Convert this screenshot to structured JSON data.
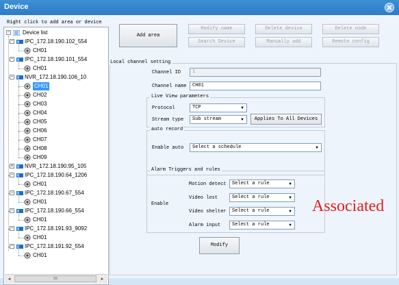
{
  "window": {
    "title": "Device"
  },
  "tree": {
    "hint": "Right click to add area or device",
    "root": "Device list",
    "items": [
      {
        "label": "IPC_172.18.190.102_554",
        "type": "device"
      },
      {
        "label": "CH01",
        "type": "channel"
      },
      {
        "label": "IPC_172.18.190.101_554",
        "type": "device"
      },
      {
        "label": "CH01",
        "type": "channel"
      },
      {
        "label": "NVR_172.18.190.106_10",
        "type": "device"
      },
      {
        "label": "CH01",
        "type": "channel",
        "selected": true
      },
      {
        "label": "CH02",
        "type": "channel"
      },
      {
        "label": "CH03",
        "type": "channel"
      },
      {
        "label": "CH04",
        "type": "channel"
      },
      {
        "label": "CH05",
        "type": "channel"
      },
      {
        "label": "CH06",
        "type": "channel"
      },
      {
        "label": "CH07",
        "type": "channel"
      },
      {
        "label": "CH08",
        "type": "channel"
      },
      {
        "label": "CH09",
        "type": "channel"
      },
      {
        "label": "NVR_172.18.190.95_105",
        "type": "device",
        "collapsed": true
      },
      {
        "label": "IPC_172.18.190.64_1206",
        "type": "device"
      },
      {
        "label": "CH01",
        "type": "channel"
      },
      {
        "label": "IPC_172.18.190.67_554",
        "type": "device"
      },
      {
        "label": "CH01",
        "type": "channel"
      },
      {
        "label": "IPC_172.18.190.66_554",
        "type": "device"
      },
      {
        "label": "CH01",
        "type": "channel"
      },
      {
        "label": "IPC_172.18.191.93_9092",
        "type": "device"
      },
      {
        "label": "CH01",
        "type": "channel"
      },
      {
        "label": "IPC_172.18.191.92_554",
        "type": "device"
      },
      {
        "label": "CH01",
        "type": "channel"
      }
    ],
    "scroll_thumb": "III"
  },
  "toolbar": {
    "add_area": "Add area",
    "modify_name": "Modify name",
    "delete_device": "Delete device",
    "delete_node": "Delete node",
    "search_device": "Search Device",
    "manually_add": "Manually add",
    "remote_config": "Remote config"
  },
  "local": {
    "group_title": "Local channel setting",
    "channel_id_label": "Channel ID",
    "channel_id_value": "1",
    "channel_name_label": "Channel name",
    "channel_name_value": "CH01",
    "live_view": {
      "title": "Live View parameters",
      "protocol_label": "Protocol",
      "protocol_value": "TCP",
      "stream_label": "Stream type",
      "stream_value": "Sub stream",
      "apply_all": "Applies To All Devices"
    },
    "auto_record": {
      "title": "auto record",
      "enable_label": "Enable auto",
      "schedule_value": "Select a schedule"
    },
    "alarm": {
      "title": "Alarm Triggers and rules",
      "enable_label": "Enable",
      "rules": [
        {
          "label": "Motion detect",
          "value": "Select a rule"
        },
        {
          "label": "Video lost",
          "value": "Select a rule"
        },
        {
          "label": "Video shelter",
          "value": "Select a rule"
        },
        {
          "label": "Alarm input",
          "value": "Select a rule"
        }
      ]
    },
    "modify_button": "Modify"
  },
  "annotation": "Associated",
  "colors": {
    "titlebar": "#3d8fd6",
    "selection": "#3399ff",
    "annotation": "#e02020"
  }
}
